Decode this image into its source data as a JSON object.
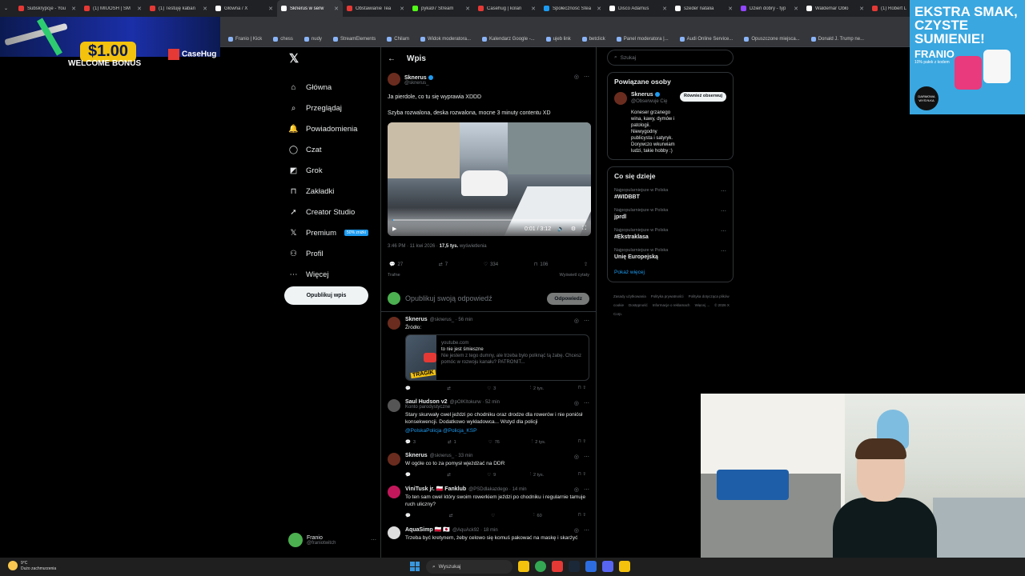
{
  "browser": {
    "tabs": [
      {
        "title": "Subskrypcje - You",
        "color": "#e53935"
      },
      {
        "title": "(1) MIUOSH | SM",
        "color": "#e53935"
      },
      {
        "title": "(1) Testuję kaban",
        "color": "#e53935"
      },
      {
        "title": "Główna / X",
        "color": "#ffffff"
      },
      {
        "title": "Sknerus w serw",
        "color": "#ffffff"
      },
      {
        "title": "Obstawianie Tea",
        "color": "#e53935"
      },
      {
        "title": "pyka97 Stream",
        "color": "#53fc18"
      },
      {
        "title": "Casehug | kolan",
        "color": "#e53935"
      },
      {
        "title": "Społeczność Stea",
        "color": "#1b9cf2"
      },
      {
        "title": "Disco Adamus",
        "color": "#ffffff"
      },
      {
        "title": "szeder natalia",
        "color": "#ffffff"
      },
      {
        "title": "Dzień dobry - typ",
        "color": "#9146ff"
      },
      {
        "title": "Waldemar Obło",
        "color": "#ffffff"
      },
      {
        "title": "(1) Robert L",
        "color": "#e53935"
      }
    ],
    "bookmarks": [
      "Franio | Kick",
      "chess",
      "nudy",
      "StreamElements",
      "Chilam",
      "Widok moderatora...",
      "Kalendarz Google -...",
      "ujeb link",
      "betclick",
      "Panel moderatora |...",
      "Audi Online Service...",
      "Opuszczone miejsca...",
      "Donald J. Trump ne..."
    ]
  },
  "ads": {
    "left": {
      "price": "$1.00",
      "bonus": "WELCOME BONUS",
      "brand": "CaseHug"
    },
    "right": {
      "headline": "EKSTRA SMAK, CZYSTE SUMIENIE!",
      "brand": "FRANIO",
      "sub": "10% pałek z kodem",
      "badge": "DARMOWA WYSYŁKA"
    }
  },
  "sidebar": {
    "logo": "𝕏",
    "items": [
      {
        "label": "Główna",
        "icon": "⌂",
        "name": "home"
      },
      {
        "label": "Przeglądaj",
        "icon": "⌕",
        "name": "explore"
      },
      {
        "label": "Powiadomienia",
        "icon": "🔔",
        "name": "notifications"
      },
      {
        "label": "Czat",
        "icon": "◯",
        "name": "chat"
      },
      {
        "label": "Grok",
        "icon": "◩",
        "name": "grok"
      },
      {
        "label": "Zakładki",
        "icon": "⊓",
        "name": "bookmarks"
      },
      {
        "label": "Creator Studio",
        "icon": "➚",
        "name": "creator-studio"
      },
      {
        "label": "Premium",
        "icon": "𝕏",
        "name": "premium"
      },
      {
        "label": "Profil",
        "icon": "⚇",
        "name": "profile"
      },
      {
        "label": "Więcej",
        "icon": "⋯",
        "name": "more"
      }
    ],
    "premium_badge": "50% zniżki",
    "post_button": "Opublikuj wpis",
    "account": {
      "name": "Franio",
      "handle": "@franiotwitch"
    }
  },
  "main": {
    "title": "Wpis",
    "post": {
      "author": "Sknerus",
      "handle": "@sknerus_",
      "text1": "Ja pierdole, co tu się wyprawia XDDD",
      "text2": "Szyba rozwalona, deska rozwalona, mocne 3 minuty contentu XD",
      "video_time": "0:01 / 3:12",
      "progress": 0.005,
      "time": "3:46 PM · 11 kwi 2026 · ",
      "views_num": "17,5 tys.",
      "views_label": " wyświetlenia",
      "stats": {
        "replies": "27",
        "reposts": "7",
        "likes": "334",
        "bookmarks": "106"
      },
      "sort": "Trafne",
      "quotes": "Wyświetl cytaty"
    },
    "reply_box": {
      "placeholder": "Opublikuj swoją odpowiedź",
      "button": "Odpowiedz"
    },
    "replies": [
      {
        "author": "Sknerus",
        "handle": "@sknerus_ · 56 min",
        "text": "Źródło:",
        "card": {
          "domain": "youtube.com",
          "title": "to nie jest śmieszne",
          "desc": "Nie jestem z tego dumny, ale trzeba było polknąć tą żabę. Chcesz pomóc w rozwoju kanału? PATRONIT...",
          "tag": "TRAGIK"
        },
        "acts": {
          "replies": "",
          "reposts": "",
          "likes": "3",
          "views": "2 tys."
        }
      },
      {
        "author": "Saul Hudson v2",
        "handle": "@pOIKItokurw · 52 min",
        "sub": "Konto parodystyczne",
        "text": "Stary skurwały cwel jeździ po chodniku oraz drodze dla rowerów i nie poniósł konsekwencji. Dodatkowo wykładowca... Wstyd dla policji",
        "links": "@PolskaPolicja @Policja_KSP",
        "acts": {
          "replies": "3",
          "reposts": "1",
          "likes": "76",
          "views": "2 tys."
        }
      },
      {
        "author": "Sknerus",
        "handle": "@sknerus_ · 33 min",
        "text": "W ogóle co to za pomysł wjeżdżać na DDR",
        "acts": {
          "replies": "",
          "reposts": "",
          "likes": "9",
          "views": "2 tys."
        }
      },
      {
        "author": "ViniTusk jr. 🇵🇱 Fanklub",
        "handle": "@PSDdlakazdego · 14 min",
        "text": "To ten sam cwel który swoim rowerkiem jeździ po chodniku i regularnie tamuje ruch uliczny?",
        "acts": {
          "replies": "",
          "reposts": "",
          "likes": "",
          "views": "60"
        }
      },
      {
        "author": "AquaSimp 🇵🇱 🇯🇵",
        "handle": "@AquAck92 · 18 min",
        "text": "Trzeba być kretynem, żeby celowo się komuś pakować na maskę i skarżyć"
      }
    ]
  },
  "right": {
    "search_placeholder": "Szukaj",
    "related": {
      "title": "Powiązane osoby",
      "name": "Sknerus",
      "handle": "@Obserwuje Cię",
      "follow": "Również obserwuj",
      "bio": "Koneser grzanego wina, kawy, dymów i patologii. Niewygodny publicysta i satyryk. Dorywczo wkurwiam ludzi, takie hobby :)"
    },
    "trends": {
      "title": "Co się dzieje",
      "items": [
        {
          "ctx": "Najpopularniejsze w Polska",
          "tag": "#WIDBBT"
        },
        {
          "ctx": "Najpopularniejsze w Polska",
          "tag": "jprdl"
        },
        {
          "ctx": "Najpopularniejsze w Polska",
          "tag": "#Ekstraklasa"
        },
        {
          "ctx": "Najpopularniejsze w Polska",
          "tag": "Unię Europejską"
        }
      ],
      "more": "Pokaż więcej"
    },
    "footer": [
      "Zasady użytkowania",
      "Polityka prywatności",
      "Polityka dotycząca plików cookie",
      "Dostępność",
      "Informacje o reklamach",
      "Więcej ...",
      "© 2026 X Corp."
    ]
  },
  "taskbar": {
    "temp": "9°C",
    "weather": "Dużo zachmurzenia",
    "search": "Wyszukaj"
  }
}
